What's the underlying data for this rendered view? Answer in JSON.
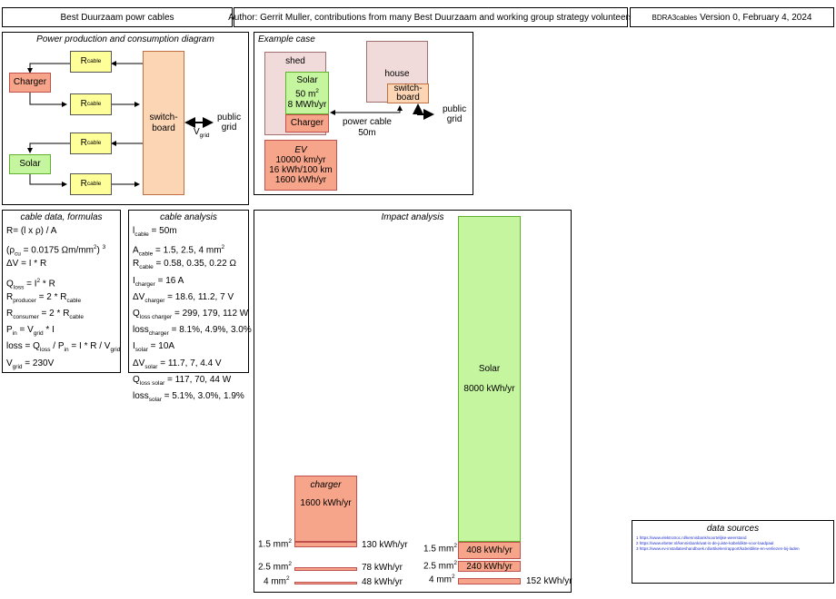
{
  "header": {
    "project": "Best Duurzaam powr cables",
    "author": "Author: Gerrit Muller, contributions from many Best Duurzaam and working group strategy volunteers",
    "doc_id": "BDRA3cables",
    "version": "Version 0, February 4, 2024"
  },
  "power_diagram": {
    "title": "Power production and consumption diagram",
    "r_label": "R",
    "r_sub": "cable",
    "charger": "Charger",
    "solar": "Solar",
    "switchboard": "switch-\nboard",
    "vgrid_label": "V",
    "vgrid_sub": "grid",
    "public_grid": "public\ngrid"
  },
  "example_case": {
    "title": "Example case",
    "shed": "shed",
    "solar": "Solar\n50 m",
    "solar_sup": "2",
    "solar_energy": "8 MWh/yr",
    "charger": "Charger",
    "house": "house",
    "switchboard": "switch-\nboard",
    "public_grid": "public\ngrid",
    "power_cable": "power cable\n50m",
    "ev_title": "EV",
    "ev_lines": [
      "10000 km/yr",
      "16 kWh/100 km",
      "1600 kWh/yr"
    ]
  },
  "formulas": {
    "title": "cable data, formulas",
    "rows": [
      [
        "R= (l x ρ) / A"
      ],
      [
        "(ρ",
        "cu",
        " = 0.0175 Ωm/mm",
        "2",
        ") ",
        "3"
      ],
      [
        "ΔV = I * R"
      ],
      [
        "Q",
        "loss",
        " = I",
        "2",
        " * R"
      ],
      [
        "R",
        "producer",
        " = 2 * R",
        "cable"
      ],
      [
        "R",
        "consumer",
        " = 2 * R",
        "cable"
      ],
      [
        "P",
        "in",
        " = V",
        "grid",
        " * I"
      ],
      [
        "loss = Q",
        "loss",
        " / P",
        "in",
        " = I * R / V",
        "grid"
      ],
      [
        "V",
        "grid",
        " = 230V"
      ]
    ]
  },
  "cable_analysis": {
    "title": "cable analysis",
    "rows": [
      [
        "l",
        "cable",
        " = 50m"
      ],
      [
        "A",
        "cable",
        " = 1.5, 2.5, 4 mm",
        "2"
      ],
      [
        "R",
        "cable",
        " = 0.58, 0.35, 0.22 Ω"
      ],
      [
        "I",
        "charger",
        " = 16 A"
      ],
      [
        "ΔV",
        "charger",
        " = 18.6, 11.2, 7 V"
      ],
      [
        "Q",
        "loss charger",
        " = 299, 179, 112 W"
      ],
      [
        "loss",
        "charger",
        " = 8.1%, 4.9%, 3.0%"
      ],
      [
        "I",
        "solar",
        " = 10A"
      ],
      [
        "ΔV",
        "solar",
        " = 11.7, 7, 4.4 V"
      ],
      [
        "Q",
        "loss solar",
        " = 117, 70, 44 W"
      ],
      [
        "loss",
        "solar",
        " = 5.1%, 3.0%, 1.9%"
      ]
    ]
  },
  "impact": {
    "title": "Impact analysis",
    "charger_label": "charger",
    "charger_value": "1600 kWh/yr",
    "solar_label": "Solar",
    "solar_value": "8000 kWh/yr",
    "charger_losses": [
      {
        "area": "1.5 mm",
        "sup": "2",
        "value": "130 kWh/yr"
      },
      {
        "area": "2.5 mm",
        "sup": "2",
        "value": "78 kWh/yr"
      },
      {
        "area": "4 mm",
        "sup": "2",
        "value": "48 kWh/yr"
      }
    ],
    "solar_losses": [
      {
        "area": "1.5 mm",
        "sup": "2",
        "value": "408 kWh/yr"
      },
      {
        "area": "2.5 mm",
        "sup": "2",
        "value": "240 kWh/yr"
      },
      {
        "area": "4 mm",
        "sup": "2",
        "value": "152 kWh/yr"
      }
    ]
  },
  "data_sources": {
    "title": "data sources",
    "items": [
      "1 https://www.elektrotroc.nl/kennisbank/soortelijke-weerstand",
      "2 https://www.ebeter.nl/kennisbank/wat-is-de-juiste-kabeldikte-voor-laadpaal",
      "3 https://www.ev-installatieshandboek.nl/artikelen/rapport/kabeldikte-en-verliezen-bij-laden"
    ]
  }
}
